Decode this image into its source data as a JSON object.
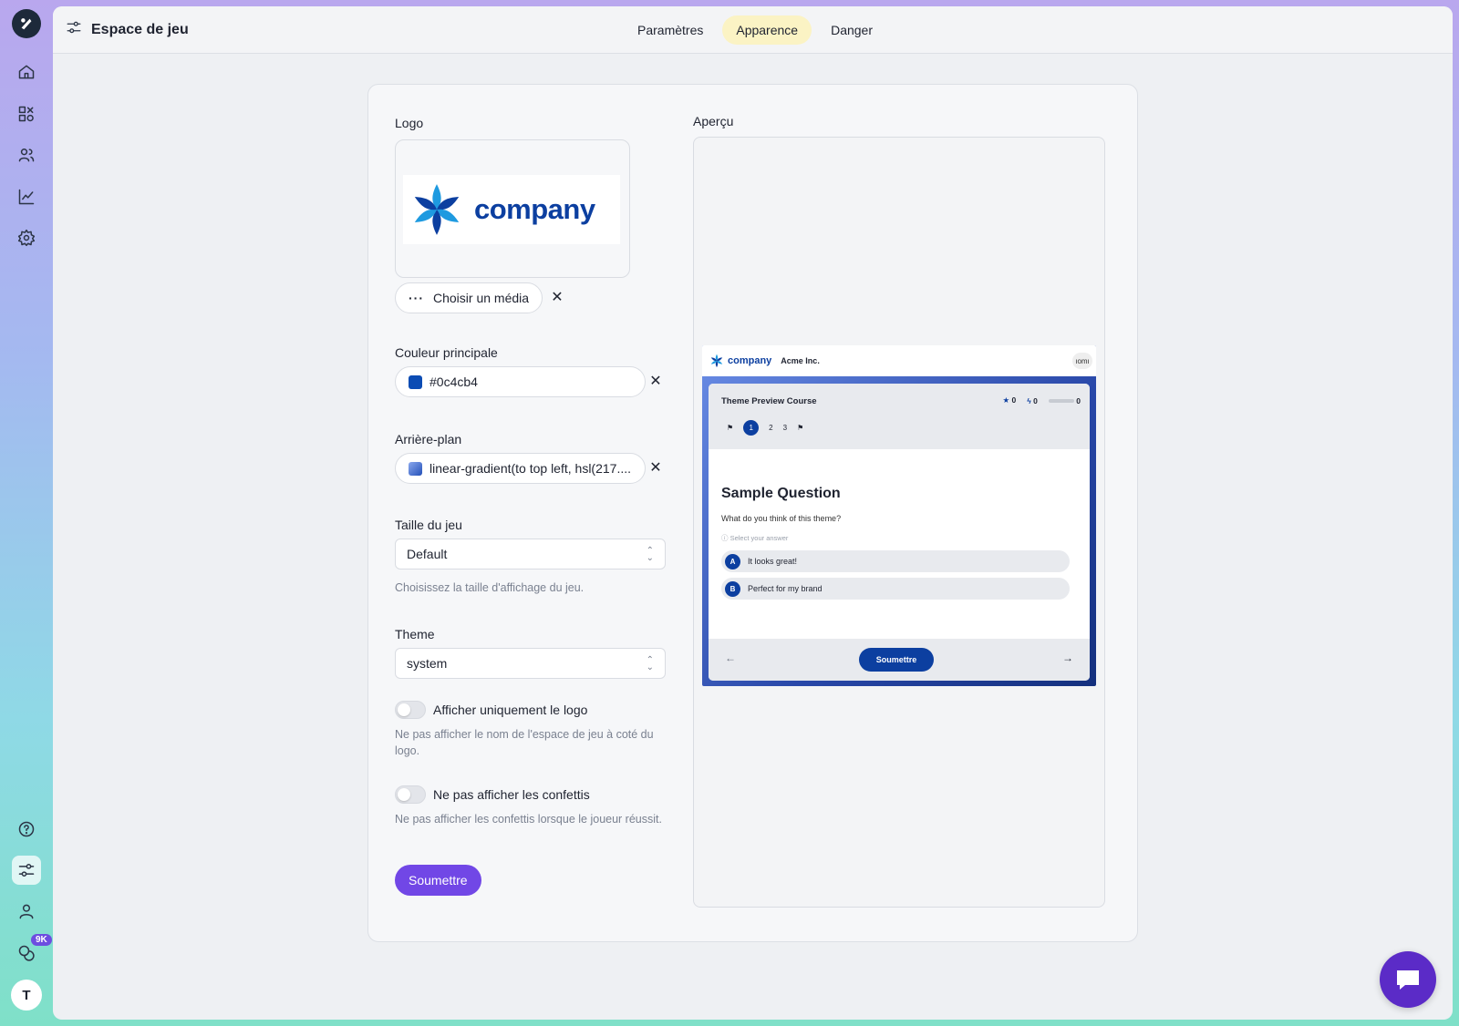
{
  "workspace": {
    "title": "Espace de jeu"
  },
  "tabs": [
    {
      "label": "Paramètres"
    },
    {
      "label": "Apparence"
    },
    {
      "label": "Danger"
    }
  ],
  "rail": {
    "badge": "9K",
    "avatar_initial": "T"
  },
  "form": {
    "logo_label": "Logo",
    "logo_text": "company",
    "choose_media": "Choisir un média",
    "primary_color_label": "Couleur principale",
    "primary_color_value": "#0c4cb4",
    "background_label": "Arrière-plan",
    "background_value": "linear-gradient(to top left, hsl(217....",
    "game_size_label": "Taille du jeu",
    "game_size_value": "Default",
    "game_size_hint": "Choisissez la taille d'affichage du jeu.",
    "theme_label": "Theme",
    "theme_value": "system",
    "logo_only_label": "Afficher uniquement le logo",
    "logo_only_hint": "Ne pas afficher le nom de l'espace de jeu à coté du logo.",
    "no_confetti_label": "Ne pas afficher les confettis",
    "no_confetti_hint": "Ne pas afficher les confettis lorsque le joueur réussit.",
    "submit": "Soumettre"
  },
  "preview": {
    "label": "Aperçu",
    "brand": "company",
    "org": "Acme Inc.",
    "avatar_text": "ıomı",
    "course": "Theme Preview Course",
    "stars": "0",
    "bolts": "0",
    "progress": "0",
    "steps": [
      "1",
      "2",
      "3"
    ],
    "question": "Sample Question",
    "question_sub": "What do you think of this theme?",
    "select_hint": "Select your answer",
    "answers": [
      {
        "letter": "A",
        "text": "It looks great!"
      },
      {
        "letter": "B",
        "text": "Perfect for my brand"
      }
    ],
    "submit": "Soumettre"
  },
  "colors": {
    "accent": "#7147e6",
    "primary": "#0c4cb4",
    "tab_active_bg": "#fbf3c4"
  }
}
